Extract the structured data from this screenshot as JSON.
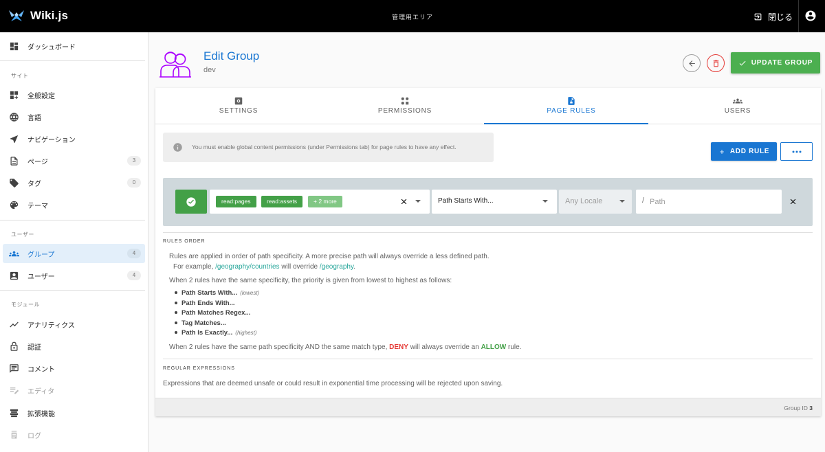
{
  "topbar": {
    "brand": "Wiki.js",
    "center_title": "管理用エリア",
    "close_label": "閉じる"
  },
  "sidebar": {
    "dashboard": "ダッシュボード",
    "section_site": "サイト",
    "general": "全般設定",
    "locale": "言語",
    "navigation": "ナビゲーション",
    "pages": "ページ",
    "pages_count": "3",
    "tags": "タグ",
    "tags_count": "0",
    "theme": "テーマ",
    "section_users": "ユーザー",
    "groups": "グループ",
    "groups_count": "4",
    "users": "ユーザー",
    "users_count": "4",
    "section_modules": "モジュール",
    "analytics": "アナリティクス",
    "auth": "認証",
    "comments": "コメント",
    "editor": "エディタ",
    "extensions": "拡張機能",
    "logging": "ログ"
  },
  "header": {
    "title": "Edit Group",
    "subtitle": "dev",
    "update_label": "UPDATE GROUP"
  },
  "tabs": {
    "settings": "SETTINGS",
    "permissions": "PERMISSIONS",
    "page_rules": "PAGE RULES",
    "users": "USERS"
  },
  "info": {
    "text": "You must enable global content permissions (under Permissions tab) for page rules to have any effect."
  },
  "actions": {
    "add_rule": "ADD RULE"
  },
  "rule": {
    "chips": [
      "read:pages",
      "read:assets",
      "+ 2 more"
    ],
    "match": "Path Starts With...",
    "locale": "Any Locale",
    "path_placeholder": "Path",
    "path_prefix": "/"
  },
  "rules_order": {
    "header": "RULES ORDER",
    "p1": "Rules are applied in order of path specificity. A more precise path will always override a less defined path.",
    "p2_prefix": "For example,",
    "p2_link1": "/geography/countries",
    "p2_mid": "will override",
    "p2_link2": "/geography",
    "p2_suffix": ".",
    "p3": "When 2 rules have the same specificity, the priority is given from lowest to highest as follows:",
    "items": [
      {
        "label": "Path Starts With...",
        "note": "(lowest)"
      },
      {
        "label": "Path Ends With...",
        "note": ""
      },
      {
        "label": "Path Matches Regex...",
        "note": ""
      },
      {
        "label": "Tag Matches...",
        "note": ""
      },
      {
        "label": "Path Is Exactly...",
        "note": "(highest)"
      }
    ],
    "p4_prefix": "When 2 rules have the same path specificity AND the same match type,",
    "p4_deny": "DENY",
    "p4_mid": "will always override an",
    "p4_allow": "ALLOW",
    "p4_suffix": "rule."
  },
  "regex": {
    "header": "REGULAR EXPRESSIONS",
    "text": "Expressions that are deemed unsafe or could result in exponential time processing will be rejected upon saving."
  },
  "footer": {
    "label": "Group ID",
    "id": "3"
  },
  "colors": {
    "primary": "#1976d2",
    "success": "#4caf50",
    "danger": "#e53935",
    "teal_link": "#26a69a"
  },
  "icons": [
    "wiki-logo-icon",
    "logout-icon",
    "account-icon",
    "dashboard-icon",
    "general-icon",
    "globe-icon",
    "navigation-icon",
    "page-icon",
    "tag-icon",
    "palette-icon",
    "groups-icon",
    "user-icon",
    "analytics-icon",
    "lock-icon",
    "comment-icon",
    "editor-icon",
    "extensions-icon",
    "log-icon",
    "group-avatar-icon",
    "arrow-left-icon",
    "trash-icon",
    "check-icon",
    "settings-icon",
    "permissions-icon",
    "page-lock-icon",
    "users-icon",
    "info-icon",
    "plus-icon",
    "dots-icon",
    "close-icon",
    "chevron-down-icon"
  ]
}
